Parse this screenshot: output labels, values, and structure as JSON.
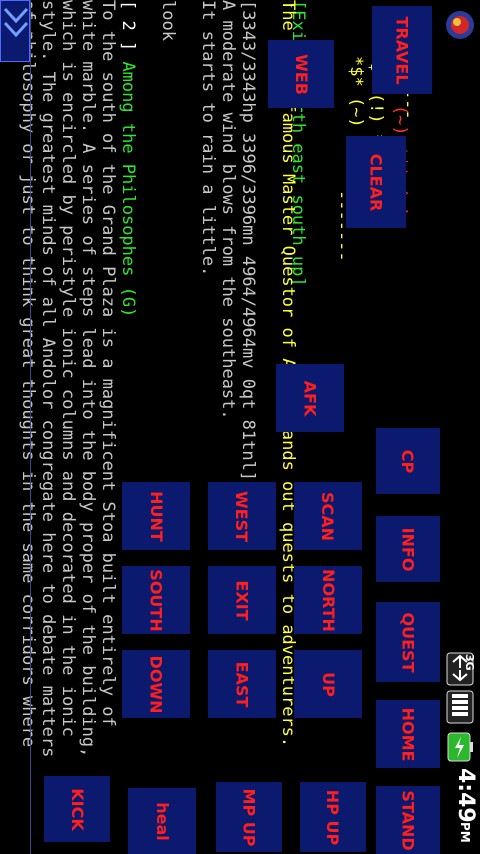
{
  "colors": {
    "background": "#000000",
    "button_bg": "#0b1a6e",
    "button_text": "#ff1f1f",
    "exits": "#2ee62e",
    "header": "#ffff33",
    "body_text": "#c8c8c8",
    "room": "#2ee62e",
    "accent": "#ff3030"
  },
  "status": {
    "time": "4:49",
    "ampm": "PM",
    "network": "3G"
  },
  "icons": {
    "app": "app-logo-icon",
    "signal": "signal-icon",
    "battery": "battery-charging-icon",
    "data": "data-transfer-icon",
    "expand": "expand-chevrons-icon"
  },
  "terminal": {
    "line1": "[Exits: north east south up]",
    "line2": "The world famous Master Questor of Aylor hands out quests to adventurers.",
    "line3": "[3343/3343hp 3396/3396mn 4964/4964mv 0qt 81tnl] >",
    "line4": "A moderate wind blows from the southeast.",
    "line5": "It starts to rain a little.",
    "line6": "",
    "line7": "look",
    "line8_num": "[ 2 ]",
    "line8_room": "Among the Philosophes (G)",
    "line9": "  To the south of the Grand Plaza is a magnificent Stoa built entirely of",
    "line10": "white marble. A series of steps lead into the body proper of the building,",
    "line11": "which is encircled by peristyle ionic columns and decorated in the ionic",
    "line12": "style.  The greatest minds of all Andolor congregate here to debate matters",
    "line13": "of philosophy or just to think great thoughts in the same corridors where",
    "banner_dashes_1": "-------",
    "banner_1": "*$* (~) *$* (~)",
    "banner_2": "*$* (!) *$* (!)",
    "banner_3": "*$* (~) *$* (~)",
    "banner_dashes_2": "-------"
  },
  "buttons": {
    "travel": "TRAVEL",
    "web": "WEB",
    "clear": "CLEAR",
    "afk": "AFK",
    "cp": "CP",
    "info": "INFO",
    "quest": "QUEST",
    "home": "HOME",
    "stand": "STAND",
    "scan": "SCAN",
    "north": "NORTH",
    "up": "UP",
    "hp_up": "HP UP",
    "west": "WEST",
    "exit": "EXIT",
    "east": "EAST",
    "mp_up": "MP UP",
    "hunt": "HUNT",
    "south": "SOUTH",
    "down": "DOWN",
    "heal": "heal",
    "kick": "KICK"
  }
}
